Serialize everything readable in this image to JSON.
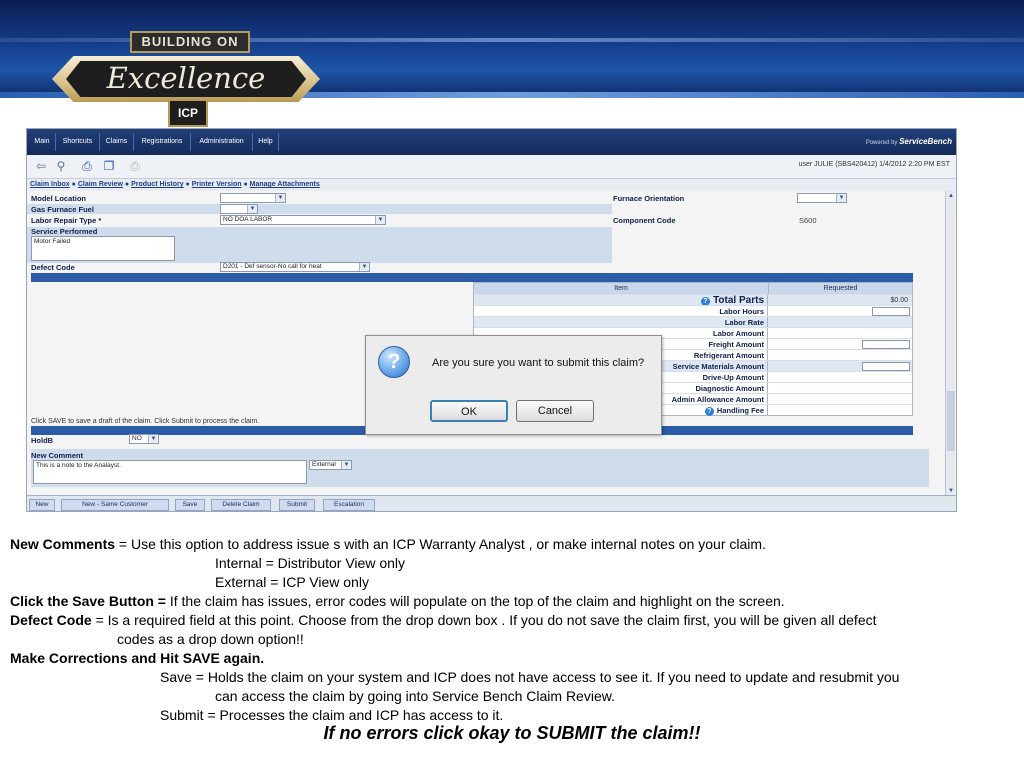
{
  "banner": {
    "logo_top": "BUILDING ON",
    "logo_main": "Excellence",
    "logo_badge": "ICP"
  },
  "menu": [
    "Main",
    "Shortcuts",
    "Claims",
    "Registrations",
    "Administration",
    "Help"
  ],
  "powered_by": {
    "prefix": "Powered by",
    "brand": "ServiceBench"
  },
  "toolbar_icons": [
    "back-icon",
    "search-icon",
    "print-icon",
    "copy-icon",
    "print-disabled-icon"
  ],
  "user_info": "user JULIE (SBS420412) 1/4/2012 2:20 PM EST",
  "links": {
    "claim_inbox": "Claim Inbox",
    "claim_review": "Claim Review",
    "product_history": "Product History",
    "printer_version": "Printer Version",
    "manage_attachments": "Manage Attachments"
  },
  "form": {
    "model_location": "Model Location",
    "gas_furnace_fuel": "Gas Furnace Fuel",
    "labor_repair_type": "Labor Repair Type *",
    "labor_repair_value": "NO DOA LABOR",
    "service_performed": "Service Performed",
    "service_performed_value": "Motor Failed",
    "defect_code": "Defect Code",
    "defect_code_value": "D201 - Def sensor-No call for heat",
    "furnace_orientation": "Furnace Orientation",
    "component_code": "Component Code",
    "component_code_value": "S600"
  },
  "parts": {
    "col_item": "Item",
    "col_requested": "Requested",
    "total_parts": "Total Parts",
    "total_parts_value": "$0.00",
    "rows": [
      "Labor Hours",
      "Labor Rate",
      "Labor Amount",
      "Freight Amount",
      "Refrigerant Amount",
      "Service Materials Amount",
      "Drive-Up Amount",
      "Diagnostic Amount",
      "Admin Allowance Amount",
      "Handling Fee"
    ]
  },
  "dialog": {
    "message": "Are you sure you want to submit this claim?",
    "ok": "OK",
    "cancel": "Cancel"
  },
  "save_hint": "Click SAVE to save a draft of the claim. Click Submit to process the claim.",
  "holdb": {
    "label": "HoldB",
    "value": "NO"
  },
  "comment": {
    "label": "New Comment",
    "value": "This is a note to the Analayst.",
    "visibility": "External"
  },
  "bottom_buttons": [
    "New",
    "New - Same Customer",
    "Save",
    "Delete Claim",
    "Submit",
    "Escalation"
  ],
  "notes": {
    "l1_bold": "New Comments",
    "l1_text": " =   Use this option to address issue s with an ICP Warranty Analyst , or make internal notes on your claim.",
    "l2": "Internal = Distributor View only",
    "l3": "External = ICP View only",
    "l4_bold": "Click the Save Button =",
    "l4_text": "  If the claim has issues, error codes will populate  on the top of the claim and highlight on the screen.",
    "l5_bold": "Defect Code",
    "l5_text": " = Is a required  field at this point.  Choose  from the drop down box .  If you do not save the claim first, you will be given all defect",
    "l6": "codes as a drop down option!!",
    "l7_bold": "Make Corrections and Hit SAVE again.",
    "l8": "Save = Holds the claim on your system and ICP does not have  access to see it.  If you need to update and resubmit you",
    "l9": "can access the claim by going into Service Bench Claim Review.",
    "l10": "Submit = Processes the claim and ICP has access to it.",
    "final": "If no errors click okay to SUBMIT the claim!!"
  }
}
